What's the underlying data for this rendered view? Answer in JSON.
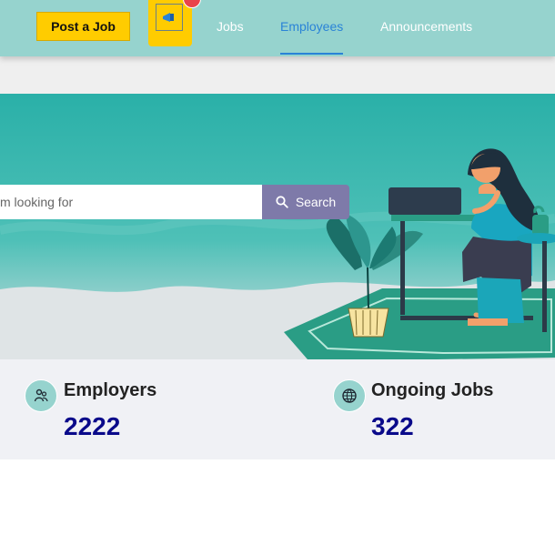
{
  "header": {
    "post_job_label": "Post a Job",
    "nav": [
      {
        "label": "Jobs",
        "active": false
      },
      {
        "label": "Employees",
        "active": true
      },
      {
        "label": "Announcements",
        "active": false
      }
    ],
    "notification_icon": "megaphone-icon",
    "colors": {
      "topbar": "#96d3ce",
      "accent": "#ffcc00",
      "active_link": "#2a83d7",
      "badge": "#e9434b"
    }
  },
  "hero": {
    "search_placeholder": "m looking for",
    "search_button_label": "Search",
    "search_icon": "search-icon",
    "search_button_color": "#7e7aa9"
  },
  "stats": [
    {
      "label": "Employers",
      "value": "2222",
      "icon": "people-icon"
    },
    {
      "label": "Ongoing Jobs",
      "value": "322",
      "icon": "globe-icon"
    }
  ]
}
